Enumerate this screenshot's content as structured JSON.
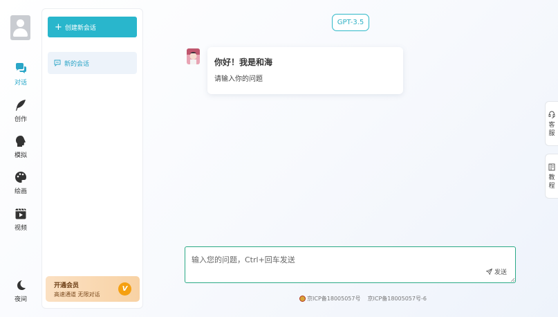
{
  "sidebar": {
    "nav": [
      {
        "label": "对话",
        "icon": "chat-bubbles-icon",
        "active": true
      },
      {
        "label": "创作",
        "icon": "feather-icon",
        "active": false
      },
      {
        "label": "模拟",
        "icon": "head-profile-icon",
        "active": false
      },
      {
        "label": "绘画",
        "icon": "palette-icon",
        "active": false
      },
      {
        "label": "视频",
        "icon": "video-play-icon",
        "active": false
      }
    ],
    "night": {
      "label": "夜间",
      "icon": "moon-icon"
    }
  },
  "panel": {
    "new_chat_label": "创建新会话",
    "chats": [
      {
        "label": "新的会话"
      }
    ],
    "vip": {
      "title": "开通会员",
      "subtitle": "高速通道 无限对话",
      "badge": "V"
    }
  },
  "main": {
    "model": "GPT-3.5",
    "greeting": {
      "title": "你好！我是和海",
      "text": "请输入你的问题"
    },
    "input": {
      "placeholder": "输入您的问题，Ctrl+回车发送",
      "send_label": "发送"
    }
  },
  "footer": {
    "icp1": "京ICP备18005057号",
    "icp2": "京ICP备18005057号-6"
  },
  "float_tabs": [
    {
      "label": "客服",
      "chars": [
        "客",
        "服"
      ],
      "icon": "headset-icon"
    },
    {
      "label": "教程",
      "chars": [
        "教",
        "程"
      ],
      "icon": "book-icon"
    }
  ],
  "colors": {
    "accent": "#29b6cc",
    "active_text": "#26a8c9",
    "input_border": "#2aa985",
    "vip_badge": "#f5a011"
  }
}
